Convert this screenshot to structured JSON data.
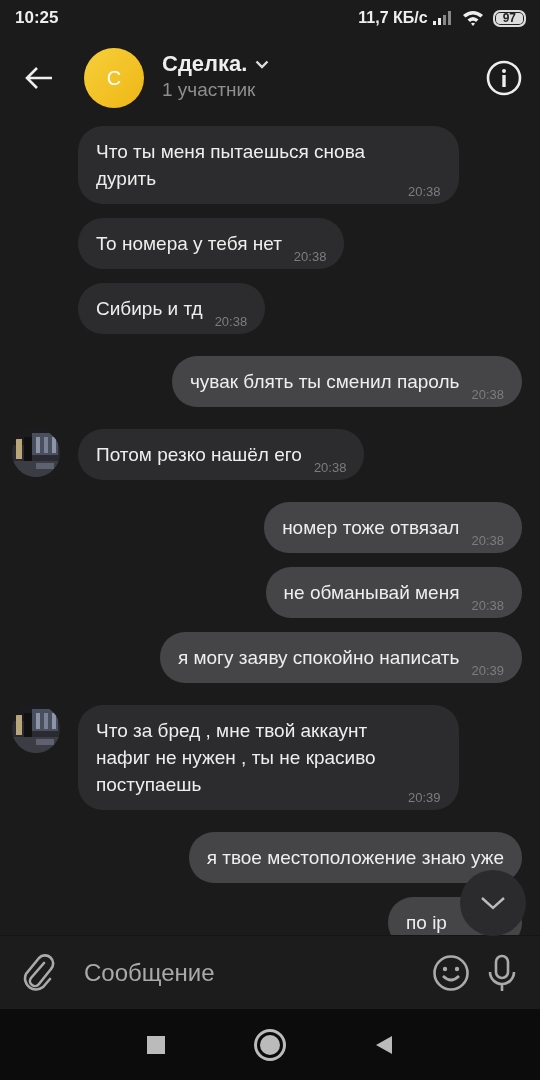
{
  "status_bar": {
    "time": "10:25",
    "speed": "11,7 КБ/с",
    "battery": "97"
  },
  "header": {
    "avatar_letter": "С",
    "title": "Сделка.",
    "subtitle": "1 участник"
  },
  "messages": [
    {
      "kind": "incoming",
      "avatar": false,
      "text": "Что ты меня пытаешься снова дурить",
      "time": "20:38"
    },
    {
      "kind": "incoming",
      "avatar": false,
      "text": "То номера у тебя нет",
      "time": "20:38"
    },
    {
      "kind": "incoming",
      "avatar": false,
      "text": "Сибирь и тд",
      "time": "20:38"
    },
    {
      "kind": "outgoing",
      "text": "чувак блять ты сменил пароль",
      "time": "20:38"
    },
    {
      "kind": "incoming",
      "avatar": true,
      "text": "Потом резко нашёл его",
      "time": "20:38"
    },
    {
      "kind": "outgoing",
      "text": "номер тоже отвязал",
      "time": "20:38"
    },
    {
      "kind": "outgoing",
      "text": "не обманывай меня",
      "time": "20:38"
    },
    {
      "kind": "outgoing",
      "text": "я могу заяву спокойно написать",
      "time": "20:39"
    },
    {
      "kind": "incoming",
      "avatar": true,
      "text": "Что за бред , мне твой аккаунт нафиг не нужен , ты не красиво поступаешь",
      "time": "20:39"
    },
    {
      "kind": "outgoing",
      "text": "я твое местоположение знаю уже"
    },
    {
      "kind": "outgoing",
      "text": "по ip"
    }
  ],
  "composer": {
    "placeholder": "Сообщение"
  }
}
